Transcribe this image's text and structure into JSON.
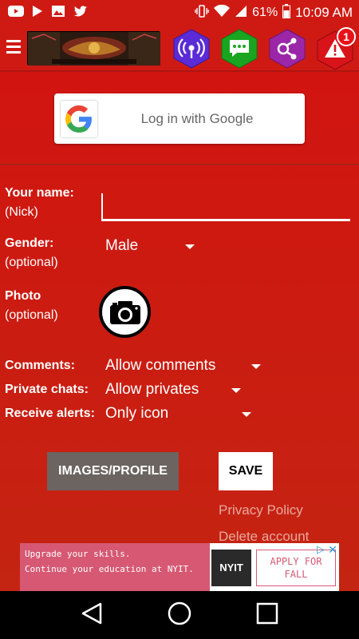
{
  "status_bar": {
    "left_icons": [
      "youtube-icon",
      "play-store-icon",
      "image-icon",
      "twitter-icon"
    ],
    "battery": "61%",
    "time": "10:09 AM"
  },
  "toolbar": {
    "menu_icon": "menu-icon",
    "icons": [
      "broadcast-icon",
      "chat-icon",
      "network-icon",
      "alert-icon"
    ],
    "alert_badge": "1"
  },
  "login": {
    "google_label": "Log in with Google"
  },
  "form": {
    "name_label": "Your name:",
    "name_hint": "(Nick)",
    "name_value": "",
    "gender_label": "Gender:",
    "gender_hint": "(optional)",
    "gender_value": "Male",
    "photo_label": "Photo",
    "photo_hint": "(optional)",
    "comments_label": "Comments:",
    "comments_value": "Allow comments",
    "private_label": "Private chats:",
    "private_value": "Allow privates",
    "alerts_label": "Receive alerts:",
    "alerts_value": "Only icon"
  },
  "buttons": {
    "images": "IMAGES/PROFILE",
    "save": "SAVE"
  },
  "links": {
    "privacy": "Privacy Policy",
    "delete": "Delete account"
  },
  "ad": {
    "line1": "Upgrade your skills.",
    "line2": "Continue your education at NYIT.",
    "logo": "NYIT",
    "cta": "APPLY FOR FALL"
  },
  "colors": {
    "primary": "#cf1a14",
    "button_gray": "#6b6461",
    "link": "#e8a99c",
    "ad_pink": "#d65873"
  }
}
